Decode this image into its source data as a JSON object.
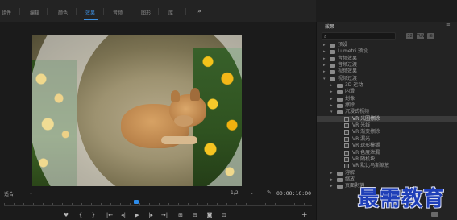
{
  "workspaces": {
    "items": [
      {
        "label": "组件"
      },
      {
        "label": "编辑"
      },
      {
        "label": "颜色"
      },
      {
        "label": "效果",
        "active": true
      },
      {
        "label": "音频"
      },
      {
        "label": "图形"
      },
      {
        "label": "库"
      }
    ],
    "more_label": "»"
  },
  "monitor": {
    "fit_label": "适合",
    "resolution_label": "1/2",
    "timecode": "00:00:10:00"
  },
  "transport": {
    "buttons": [
      "♥",
      "{",
      "}",
      "|←",
      "◂|",
      "▶",
      "|▸",
      "→|",
      "⊞",
      "⊟",
      "◙",
      "⊡"
    ],
    "add_label": "+"
  },
  "effects_panel": {
    "title": "效果",
    "menu_label": "≡",
    "search_icon": "⌕",
    "search_value": "",
    "tools": [
      "32",
      "YUV",
      "⊞"
    ],
    "tree": [
      {
        "label": "预设",
        "level": 0,
        "type": "folder",
        "expanded": false
      },
      {
        "label": "Lumetri 预设",
        "level": 0,
        "type": "folder",
        "expanded": false
      },
      {
        "label": "音频效果",
        "level": 0,
        "type": "folder",
        "expanded": false
      },
      {
        "label": "音频过渡",
        "level": 0,
        "type": "folder",
        "expanded": false
      },
      {
        "label": "视频效果",
        "level": 0,
        "type": "folder",
        "expanded": false
      },
      {
        "label": "视频过渡",
        "level": 0,
        "type": "folder",
        "expanded": true
      },
      {
        "label": "3D 运动",
        "level": 1,
        "type": "folder",
        "expanded": false
      },
      {
        "label": "内滑",
        "level": 1,
        "type": "folder",
        "expanded": false
      },
      {
        "label": "划像",
        "level": 1,
        "type": "folder",
        "expanded": false
      },
      {
        "label": "擦除",
        "level": 1,
        "type": "folder",
        "expanded": false
      },
      {
        "label": "沉浸式视频",
        "level": 1,
        "type": "folder",
        "expanded": true
      },
      {
        "label": "VR 光圈擦除",
        "level": 2,
        "type": "effect",
        "selected": true
      },
      {
        "label": "VR 光线",
        "level": 2,
        "type": "effect"
      },
      {
        "label": "VR 渐变擦除",
        "level": 2,
        "type": "effect"
      },
      {
        "label": "VR 漏光",
        "level": 2,
        "type": "effect"
      },
      {
        "label": "VR 球形模糊",
        "level": 2,
        "type": "effect"
      },
      {
        "label": "VR 色度泄漏",
        "level": 2,
        "type": "effect"
      },
      {
        "label": "VR 随机块",
        "level": 2,
        "type": "effect"
      },
      {
        "label": "VR 默比乌斯缩放",
        "level": 2,
        "type": "effect"
      },
      {
        "label": "溶解",
        "level": 1,
        "type": "folder",
        "expanded": false
      },
      {
        "label": "缩放",
        "level": 1,
        "type": "folder",
        "expanded": false
      },
      {
        "label": "页面剥落",
        "level": 1,
        "type": "folder",
        "expanded": false
      }
    ]
  },
  "watermark": "最需教育",
  "colors": {
    "accent": "#3d8fe0",
    "background": "#1d1d1d",
    "panel": "#232323"
  }
}
